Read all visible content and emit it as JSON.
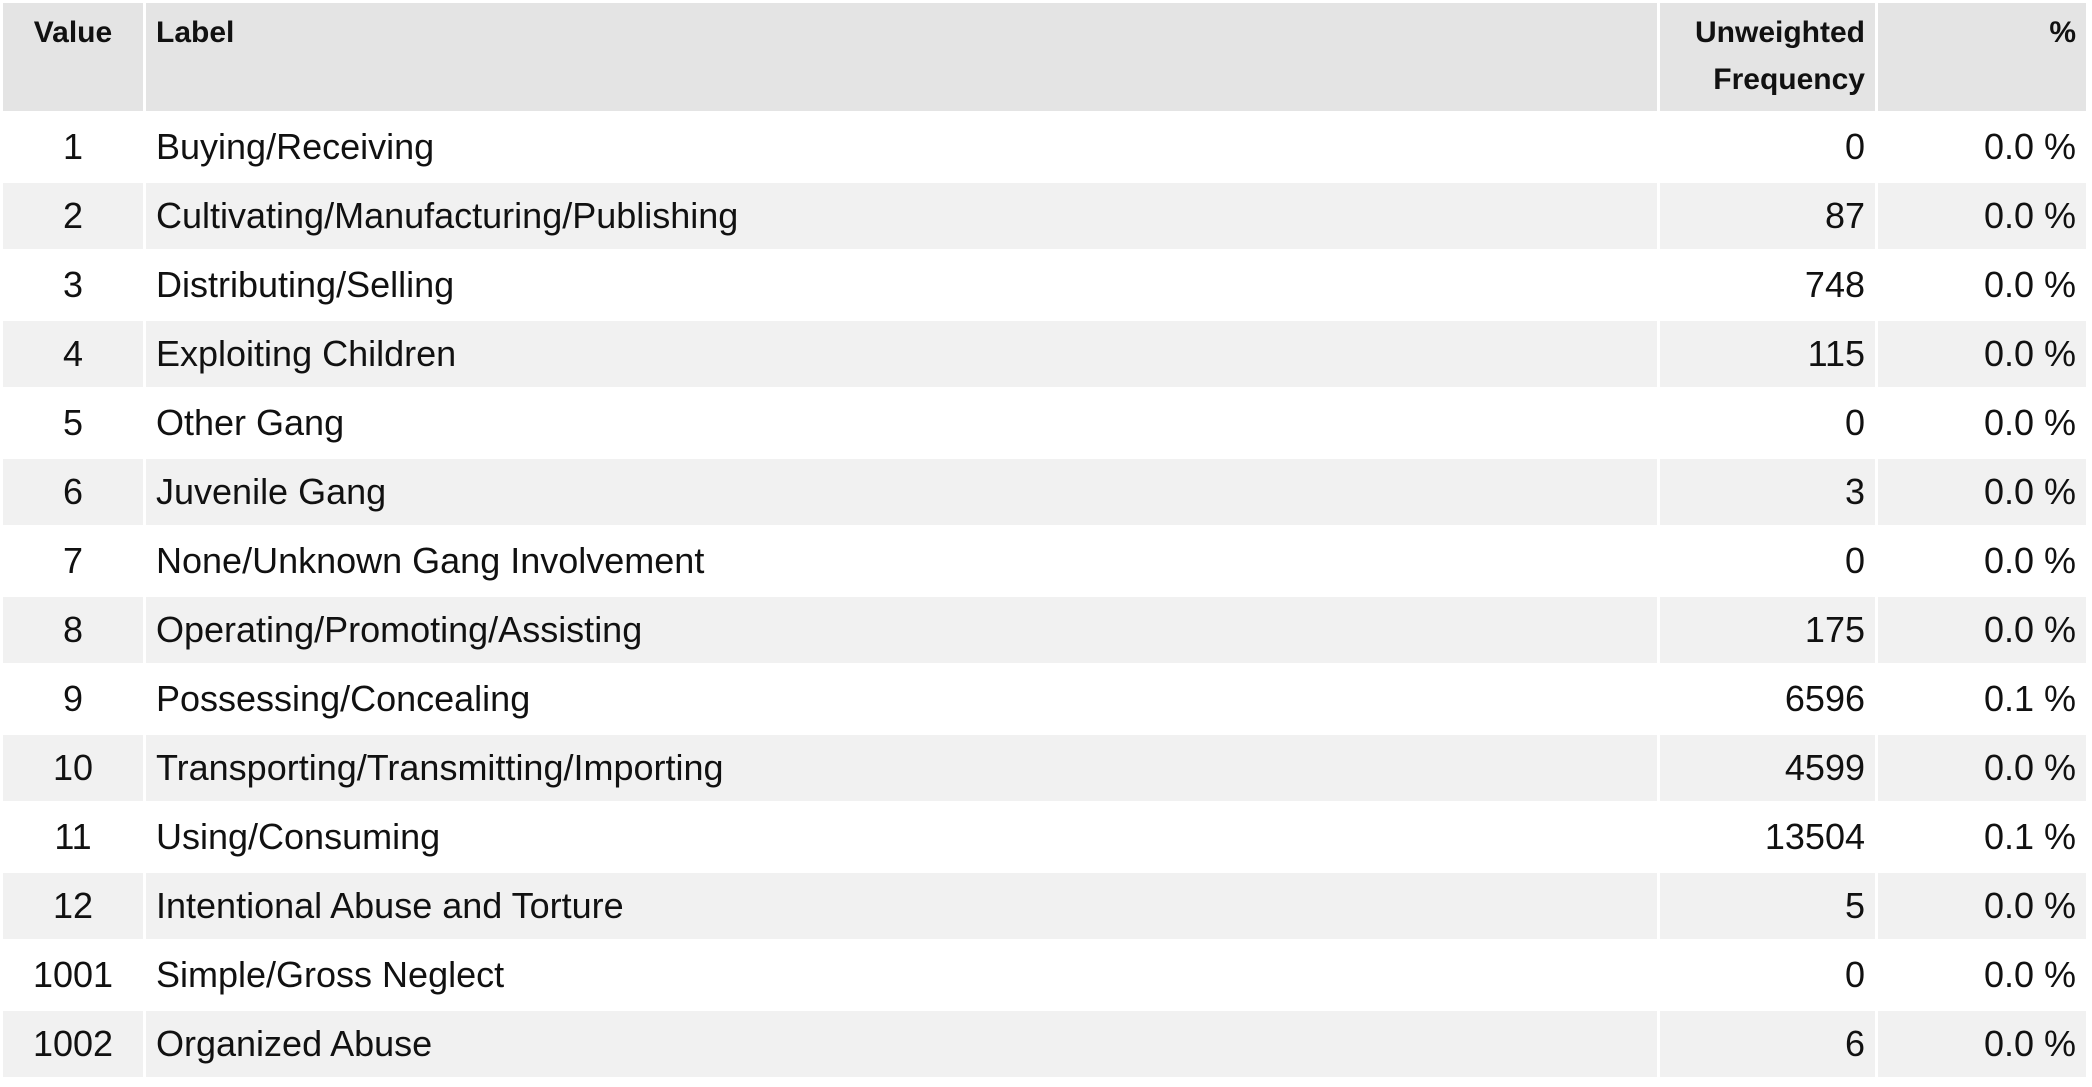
{
  "table": {
    "headers": {
      "value": "Value",
      "label": "Label",
      "freq_line1": "Unweighted",
      "freq_line2": "Frequency",
      "pct": "%"
    },
    "rows": [
      {
        "value": "1",
        "label": "Buying/Receiving",
        "freq": "0",
        "pct": "0.0 %"
      },
      {
        "value": "2",
        "label": "Cultivating/Manufacturing/Publishing",
        "freq": "87",
        "pct": "0.0 %"
      },
      {
        "value": "3",
        "label": "Distributing/Selling",
        "freq": "748",
        "pct": "0.0 %"
      },
      {
        "value": "4",
        "label": "Exploiting Children",
        "freq": "115",
        "pct": "0.0 %"
      },
      {
        "value": "5",
        "label": "Other Gang",
        "freq": "0",
        "pct": "0.0 %"
      },
      {
        "value": "6",
        "label": "Juvenile Gang",
        "freq": "3",
        "pct": "0.0 %"
      },
      {
        "value": "7",
        "label": "None/Unknown Gang Involvement",
        "freq": "0",
        "pct": "0.0 %"
      },
      {
        "value": "8",
        "label": "Operating/Promoting/Assisting",
        "freq": "175",
        "pct": "0.0 %"
      },
      {
        "value": "9",
        "label": "Possessing/Concealing",
        "freq": "6596",
        "pct": "0.1 %"
      },
      {
        "value": "10",
        "label": "Transporting/Transmitting/Importing",
        "freq": "4599",
        "pct": "0.0 %"
      },
      {
        "value": "11",
        "label": "Using/Consuming",
        "freq": "13504",
        "pct": "0.1 %"
      },
      {
        "value": "12",
        "label": "Intentional Abuse and Torture",
        "freq": "5",
        "pct": "0.0 %"
      },
      {
        "value": "1001",
        "label": "Simple/Gross Neglect",
        "freq": "0",
        "pct": "0.0 %"
      },
      {
        "value": "1002",
        "label": "Organized Abuse",
        "freq": "6",
        "pct": "0.0 %"
      }
    ]
  }
}
